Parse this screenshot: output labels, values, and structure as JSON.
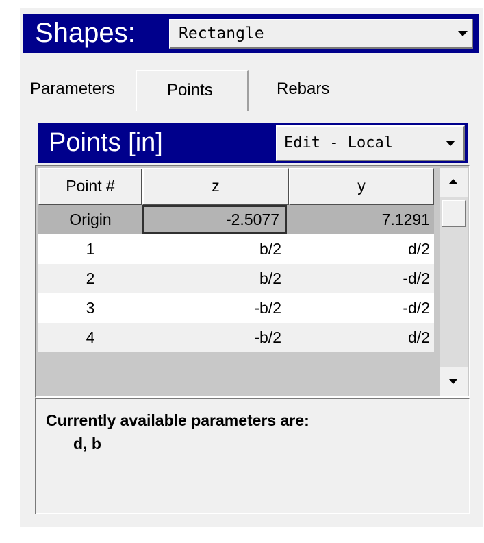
{
  "shapes": {
    "label": "Shapes:",
    "selected": "Rectangle"
  },
  "tabs": [
    {
      "label": "Parameters"
    },
    {
      "label": "Points",
      "active": true
    },
    {
      "label": "Rebars"
    }
  ],
  "points_panel": {
    "title": "Points [in]",
    "mode": "Edit - Local"
  },
  "grid": {
    "headers": [
      "Point #",
      "z",
      "y"
    ],
    "rows": [
      {
        "point": "Origin",
        "z": "-2.5077",
        "y": "7.1291"
      },
      {
        "point": "1",
        "z": "b/2",
        "y": "d/2"
      },
      {
        "point": "2",
        "z": "b/2",
        "y": "-d/2"
      },
      {
        "point": "3",
        "z": "-b/2",
        "y": "-d/2"
      },
      {
        "point": "4",
        "z": "-b/2",
        "y": "d/2"
      }
    ]
  },
  "info": {
    "line1": "Currently available parameters are:",
    "line2": "d, b"
  },
  "colors": {
    "header_bar": "#00008c",
    "panel_bg": "#f0f0f0",
    "selected_row": "#b4b4b4"
  }
}
